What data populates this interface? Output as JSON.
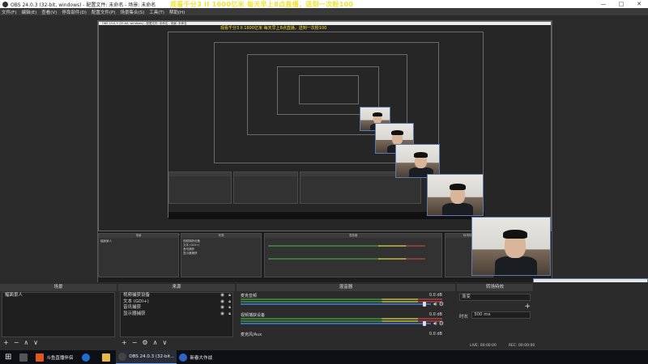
{
  "window": {
    "title": "OBS 24.0.3 (32-bit, windows) - 配置文件: 未命名 - 场景: 未命名",
    "controls": [
      "—",
      "□",
      "✕"
    ]
  },
  "menubar": [
    "文件(F)",
    "编辑(E)",
    "查看(V)",
    "停靠部件(D)",
    "配置文件(P)",
    "场景集合(S)",
    "工具(T)",
    "帮助(H)"
  ],
  "overlay_text": "观看千分3 II 1600亿米 每天早上8点直播，送到一次粉100",
  "inner_title": "OBS 24.0.3 (32-bit, windows) - 配置文件: 未命名 - 场景: 未命名",
  "inner_overlay_text": "观看千分3 II 1600亿米 每天早上8点直播，送到一次粉100",
  "docks": {
    "scenes": {
      "title": "场景",
      "items": [
        "幅面景人"
      ]
    },
    "sources": {
      "title": "来源",
      "items": [
        "视频捕获设备",
        "文本 (GDI+)",
        "音讯捕获",
        "显示器捕获"
      ]
    },
    "mixer": {
      "title": "混音器",
      "tracks": [
        {
          "name": "麦克音频",
          "db": "0.0 dB"
        },
        {
          "name": "视频捕获设备",
          "db": "0.0 dB"
        },
        {
          "name": "麦克风/Aux",
          "db": "0.0 dB"
        }
      ]
    },
    "transitions": {
      "title": "转场特效",
      "type": "渐变",
      "duration_label": "时长",
      "duration_value": "300 ms",
      "lve": "LIVE: 00:00:00",
      "rec": "REC: 00:00:00"
    }
  },
  "footer_icons": {
    "add": "+",
    "remove": "−",
    "up": "∧",
    "down": "∨",
    "gear": "⚙"
  },
  "taskbar": {
    "start": "⊞",
    "items": [
      {
        "label": "斗鱼直播伴侣",
        "color": "#e2571e",
        "active": false
      },
      {
        "label": "",
        "color": "#1f6fd0",
        "active": false
      },
      {
        "label": "",
        "color": "#e8b84a",
        "active": false
      },
      {
        "label": "OBS 24.0.3 (32-bit...",
        "color": "#444444",
        "active": true
      },
      {
        "label": "新春大作战",
        "color": "#2a66c8",
        "active": false
      }
    ]
  },
  "colors": {
    "overlay_text": "#f2e22c",
    "accent_blue": "#3b6bb5",
    "panel_bg": "#2b2b2b"
  }
}
